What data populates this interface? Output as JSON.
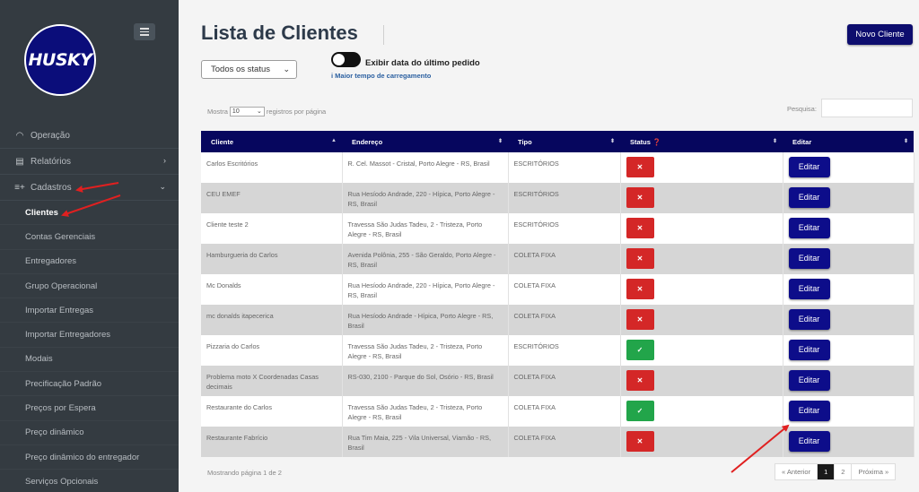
{
  "logo_text": "HUSKY",
  "nav": {
    "items": [
      {
        "label": "Operação",
        "icon": "gauge-icon"
      },
      {
        "label": "Relatórios",
        "icon": "report-icon",
        "chevron": "›"
      },
      {
        "label": "Cadastros",
        "icon": "add-list-icon",
        "chevron": "⌄"
      }
    ],
    "sub_items": [
      "Clientes",
      "Contas Gerenciais",
      "Entregadores",
      "Grupo Operacional",
      "Importar Entregas",
      "Importar Entregadores",
      "Modais",
      "Precificação Padrão",
      "Preços por Espera",
      "Preço dinâmico",
      "Preço dinâmico do entregador",
      "Serviços Opcionais"
    ]
  },
  "header": {
    "title": "Lista de Clientes",
    "new_button": "Novo Cliente"
  },
  "filters": {
    "status_value": "Todos os status",
    "toggle_label": "Exibir data do último pedido",
    "load_note": "i Maior tempo de carregamento"
  },
  "table_controls": {
    "show_prefix": "Mostra",
    "page_length": "10",
    "show_suffix": "registros por página",
    "search_label": "Pesquisa:",
    "search_value": ""
  },
  "table": {
    "columns": [
      "Cliente",
      "Endereço",
      "Tipo",
      "Status",
      "Editar"
    ],
    "rows": [
      {
        "cliente": "Carlos Escritórios",
        "endereco": "R. Cel. Massot - Cristal, Porto Alegre - RS, Brasil",
        "tipo": "ESCRITÓRIOS",
        "status": "✕",
        "editar": "Editar"
      },
      {
        "cliente": "CEU EMEF",
        "endereco": "Rua Hesíodo Andrade, 220 - Hípica, Porto Alegre - RS, Brasil",
        "tipo": "ESCRITÓRIOS",
        "status": "✕",
        "editar": "Editar"
      },
      {
        "cliente": "Cliente teste 2",
        "endereco": "Travessa São Judas Tadeu, 2 - Tristeza, Porto Alegre - RS, Brasil",
        "tipo": "ESCRITÓRIOS",
        "status": "✕",
        "editar": "Editar"
      },
      {
        "cliente": "Hamburgueria do Carlos",
        "endereco": "Avenida Polônia, 255 - São Geraldo, Porto Alegre - RS, Brasil",
        "tipo": "COLETA FIXA",
        "status": "✕",
        "editar": "Editar"
      },
      {
        "cliente": "Mc Donalds",
        "endereco": "Rua Hesíodo Andrade, 220 - Hípica, Porto Alegre - RS, Brasil",
        "tipo": "COLETA FIXA",
        "status": "✕",
        "editar": "Editar"
      },
      {
        "cliente": "mc donalds itapecerica",
        "endereco": "Rua Hesíodo Andrade - Hípica, Porto Alegre - RS, Brasil",
        "tipo": "COLETA FIXA",
        "status": "✕",
        "editar": "Editar"
      },
      {
        "cliente": "Pizzaria do Carlos",
        "endereco": "Travessa São Judas Tadeu, 2 - Tristeza, Porto Alegre - RS, Brasil",
        "tipo": "ESCRITÓRIOS",
        "status": "✓",
        "editar": "Editar"
      },
      {
        "cliente": "Problema moto X Coordenadas Casas decimais",
        "endereco": "RS-030, 2100 - Parque do Sol, Osório - RS, Brasil",
        "tipo": "COLETA FIXA",
        "status": "✕",
        "editar": "Editar"
      },
      {
        "cliente": "Restaurante do Carlos",
        "endereco": "Travessa São Judas Tadeu, 2 - Tristeza, Porto Alegre - RS, Brasil",
        "tipo": "COLETA FIXA",
        "status": "✓",
        "editar": "Editar"
      },
      {
        "cliente": "Restaurante Fabrício",
        "endereco": "Rua Tim Maia, 225 - Vila Universal, Viamão - RS, Brasil",
        "tipo": "COLETA FIXA",
        "status": "✕",
        "editar": "Editar"
      }
    ]
  },
  "footer": {
    "info": "Mostrando página 1 de 2",
    "prev": "« Anterior",
    "pages": [
      "1",
      "2"
    ],
    "next": "Próxima »"
  },
  "colors": {
    "sidebar": "#343b41",
    "header_bg": "#06065e",
    "button_blue": "#0d0d8a",
    "status_inactive": "#d42727",
    "status_active": "#22a54a",
    "annotation_arrow": "#e02020"
  }
}
